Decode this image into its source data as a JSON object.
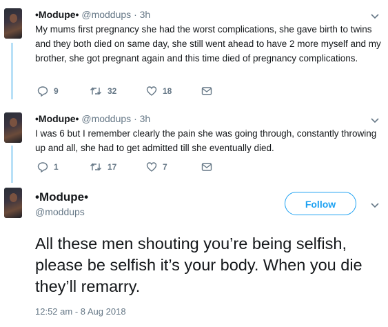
{
  "tweets": [
    {
      "name": "•Modupe•",
      "handle": "@moddups",
      "time": "· 3h",
      "text": "My mums first pregnancy she had the worst complications, she gave birth to twins and they both died on same day, she still went ahead to have 2 more myself and my brother, she got pregnant again and this time died of pregnancy complications.",
      "replies": "9",
      "retweets": "32",
      "likes": "18"
    },
    {
      "name": "•Modupe•",
      "handle": "@moddups",
      "time": "· 3h",
      "text": "I was 6 but I remember clearly the pain she was going through, constantly throwing up and all, she had to get admitted till she eventually died.",
      "replies": "1",
      "retweets": "17",
      "likes": "7"
    }
  ],
  "main": {
    "name": "•Modupe•",
    "handle": "@moddups",
    "follow_label": "Follow",
    "text": "All these men shouting you’re being selfish, please be selfish it’s your body. When you die they’ll remarry.",
    "timestamp": "12:52 am - 8 Aug 2018"
  },
  "colors": {
    "accent": "#1da1f2",
    "thread_line": "#b8e0f7",
    "muted": "#657786"
  },
  "icons": [
    "reply-icon",
    "retweet-icon",
    "like-icon",
    "message-icon",
    "chevron-down-icon"
  ]
}
